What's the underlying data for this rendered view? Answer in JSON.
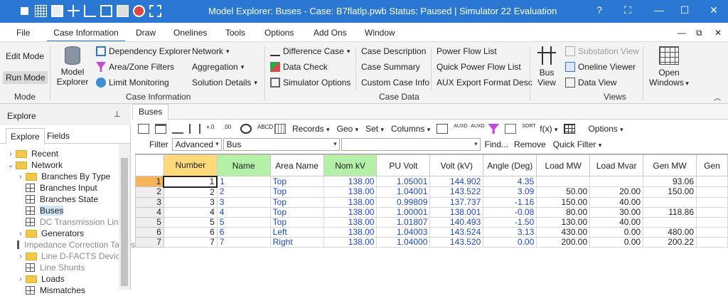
{
  "titlebar": {
    "title": "Model Explorer: Buses - Case: B7flatlp.pwb  Status: Paused | Simulator 22 Evaluation",
    "controls": {
      "help": "?",
      "pin": "⛶",
      "minimize": "—",
      "maximize": "☐",
      "close": "✕"
    }
  },
  "menu": {
    "items": [
      "File",
      "Case Information",
      "Draw",
      "Onelines",
      "Tools",
      "Options",
      "Add Ons",
      "Window"
    ],
    "active": "Case Information",
    "right_controls": [
      "—",
      "⧉",
      "✕"
    ]
  },
  "ribbon": {
    "mode": {
      "edit": "Edit Mode",
      "run": "Run Mode",
      "group": "Mode"
    },
    "model_explorer": {
      "line1": "Model",
      "line2": "Explorer"
    },
    "case_info": {
      "dependency_explorer": "Dependency Explorer",
      "area_zone_filters": "Area/Zone Filters",
      "limit_monitoring": "Limit Monitoring",
      "network": "Network",
      "aggregation": "Aggregation",
      "solution_details": "Solution Details",
      "group": "Case Information"
    },
    "case_data": {
      "difference_case": "Difference Case",
      "data_check": "Data Check",
      "simulator_options": "Simulator Options",
      "case_description": "Case Description",
      "case_summary": "Case Summary",
      "custom_case_info": "Custom Case Info",
      "power_flow_list": "Power Flow List",
      "quick_power_flow_list": "Quick Power Flow List",
      "aux_export": "AUX Export Format Desc",
      "group": "Case Data"
    },
    "views": {
      "bus_view_1": "Bus",
      "bus_view_2": "View",
      "substation_view": "Substation View",
      "oneline_viewer": "Oneline Viewer",
      "data_view": "Data View",
      "group": "Views"
    },
    "open_windows": {
      "line1": "Open",
      "line2": "Windows"
    }
  },
  "explore": {
    "title": "Explore",
    "tabs": [
      "Explore",
      "Fields"
    ],
    "tree": [
      {
        "label": "Recent",
        "icon": "folder-icon",
        "chev": "›",
        "indent": 0
      },
      {
        "label": "Network",
        "icon": "folder-icon",
        "chev": "⌄",
        "indent": 0
      },
      {
        "label": "Branches By Type",
        "icon": "folder-icon",
        "chev": "›",
        "indent": 1
      },
      {
        "label": "Branches Input",
        "icon": "grid-icon",
        "chev": "",
        "indent": 1
      },
      {
        "label": "Branches State",
        "icon": "grid-icon",
        "chev": "",
        "indent": 1
      },
      {
        "label": "Buses",
        "icon": "grid-icon",
        "chev": "",
        "indent": 1,
        "selected": true
      },
      {
        "label": "DC Transmission Lines",
        "icon": "grid-icon",
        "chev": "",
        "indent": 1,
        "dim": true
      },
      {
        "label": "Generators",
        "icon": "folder-icon",
        "chev": "›",
        "indent": 1
      },
      {
        "label": "Impedance Correction Tables",
        "icon": "grid-icon",
        "chev": "",
        "indent": 1,
        "dim": true
      },
      {
        "label": "Line D-FACTS Devices",
        "icon": "folder-icon",
        "chev": "›",
        "indent": 1,
        "dim": true
      },
      {
        "label": "Line Shunts",
        "icon": "grid-icon",
        "chev": "",
        "indent": 1,
        "dim": true
      },
      {
        "label": "Loads",
        "icon": "folder-icon",
        "chev": "›",
        "indent": 1
      },
      {
        "label": "Mismatches",
        "icon": "grid-icon",
        "chev": "",
        "indent": 1
      }
    ]
  },
  "doc_tab": "Buses",
  "toolbar": {
    "records": "Records",
    "geo": "Geo",
    "set": "Set",
    "columns": "Columns",
    "options": "Options",
    "fx": "f(x)"
  },
  "filter": {
    "label": "Filter",
    "mode": "Advanced",
    "object": "Bus",
    "condition": "",
    "find": "Find...",
    "remove": "Remove",
    "quick_filter": "Quick Filter"
  },
  "table": {
    "columns": [
      "Number",
      "Name",
      "Area Name",
      "Nom kV",
      "PU Volt",
      "Volt (kV)",
      "Angle (Deg)",
      "Load MW",
      "Load Mvar",
      "Gen MW",
      "Gen"
    ],
    "rows": [
      [
        "1",
        "1",
        "1",
        "Top",
        "138.00",
        "1.05001",
        "144.902",
        "4.35",
        "",
        "",
        "93.06"
      ],
      [
        "2",
        "2",
        "2",
        "Top",
        "138.00",
        "1.04001",
        "143.522",
        "3.09",
        "50.00",
        "20.00",
        "150.00"
      ],
      [
        "3",
        "3",
        "3",
        "Top",
        "138.00",
        "0.99809",
        "137.737",
        "-1.16",
        "150.00",
        "40.00",
        ""
      ],
      [
        "4",
        "4",
        "4",
        "Top",
        "138.00",
        "1.00001",
        "138.001",
        "-0.08",
        "80.00",
        "30.00",
        "118.86"
      ],
      [
        "5",
        "5",
        "5",
        "Top",
        "138.00",
        "1.01807",
        "140.493",
        "-1.50",
        "130.00",
        "40.00",
        ""
      ],
      [
        "6",
        "6",
        "6",
        "Left",
        "138.00",
        "1.04003",
        "143.524",
        "3.13",
        "430.00",
        "0.00",
        "480.00"
      ],
      [
        "7",
        "7",
        "7",
        "Right",
        "138.00",
        "1.04000",
        "143.520",
        "0.00",
        "200.00",
        "0.00",
        "200.22"
      ]
    ]
  },
  "colors": {
    "titlebar": "#2b78d4",
    "key_header": "#ffd97a",
    "input_header": "#b4f0a8",
    "current_row": "#f7b35a",
    "link_text": "#1f47c8"
  }
}
